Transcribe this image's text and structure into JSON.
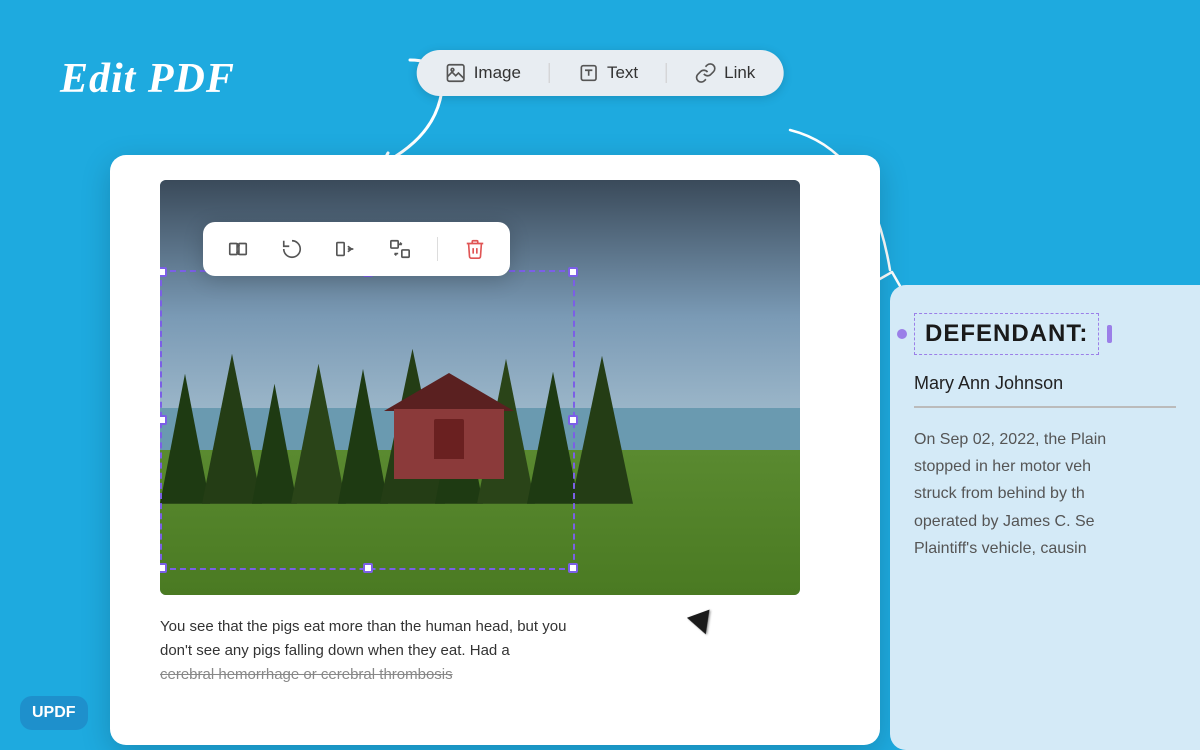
{
  "background_color": "#1eaadf",
  "title": "Edit PDF",
  "toolbar": {
    "image_label": "Image",
    "text_label": "Text",
    "link_label": "Link"
  },
  "document": {
    "body_text_line1": "You see that the pigs eat more than the human head, but you",
    "body_text_line2": "don't see any pigs falling down when they eat. Had a",
    "body_text_line3": "cerebral hemorrhage or cerebral thrombosis"
  },
  "right_panel": {
    "label": "DEFENDANT:",
    "name": "Mary Ann Johnson",
    "body": "On Sep 02, 2022, the Plain stopped in her motor veh struck from behind by th operated by James C. Se Plaintiff's vehicle, causin"
  },
  "image_tools": [
    {
      "name": "replace-image",
      "label": "Replace"
    },
    {
      "name": "rotate-left",
      "label": "Rotate Left"
    },
    {
      "name": "flip",
      "label": "Flip"
    },
    {
      "name": "swap",
      "label": "Swap"
    },
    {
      "name": "delete",
      "label": "Delete"
    }
  ],
  "logo": "UPDF"
}
